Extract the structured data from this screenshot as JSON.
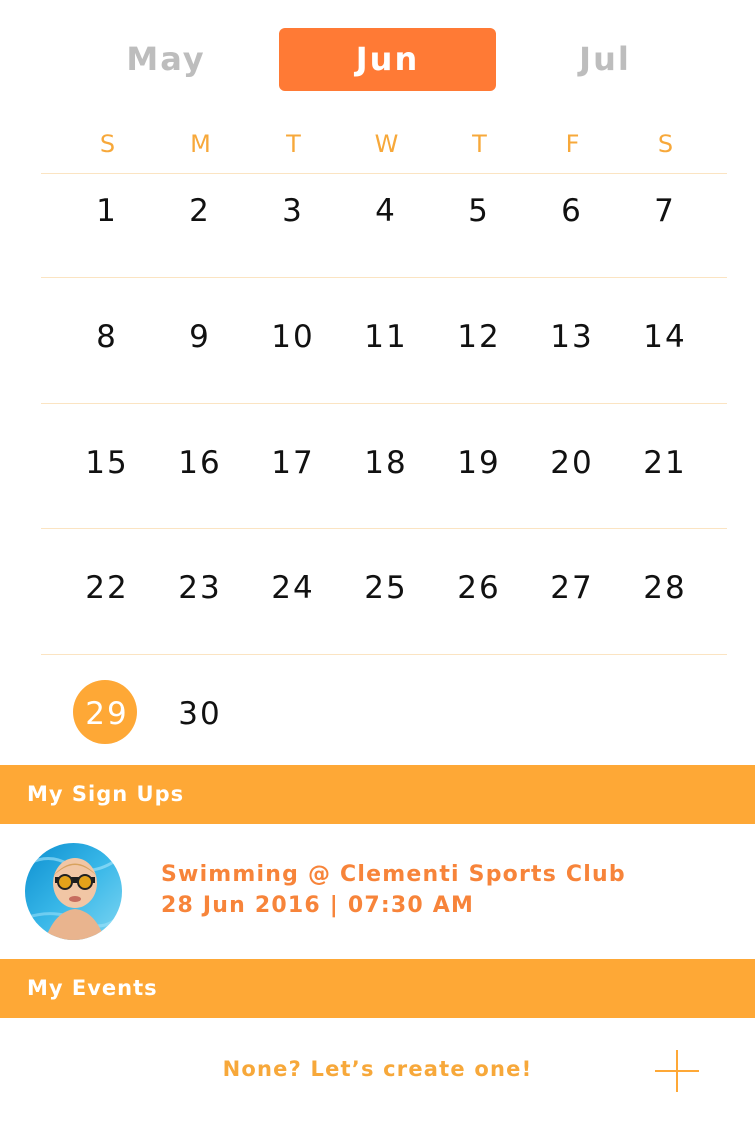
{
  "months": {
    "prev": "May",
    "current": "Jun",
    "next": "Jul"
  },
  "weekdays": [
    "S",
    "M",
    "T",
    "W",
    "T",
    "F",
    "S"
  ],
  "weeks": [
    [
      "1",
      "2",
      "3",
      "4",
      "5",
      "6",
      "7"
    ],
    [
      "8",
      "9",
      "10",
      "11",
      "12",
      "13",
      "14"
    ],
    [
      "15",
      "16",
      "17",
      "18",
      "19",
      "20",
      "21"
    ],
    [
      "22",
      "23",
      "24",
      "25",
      "26",
      "27",
      "28"
    ],
    [
      "29",
      "30"
    ]
  ],
  "today": "29",
  "sections": {
    "signups": "My Sign Ups",
    "events": "My Events"
  },
  "signup": {
    "title": "Swimming @ Clementi Sports Club",
    "datetime": "28 Jun 2016 | 07:30 AM"
  },
  "events": {
    "empty_text": "None? Let’s create one!"
  },
  "colors": {
    "accent": "#ff7a35",
    "section": "#fea836",
    "weekday": "#f7a83a",
    "event_text": "#f7843a"
  },
  "icons": {
    "add": "plus-icon",
    "avatar": "swimmer-avatar"
  }
}
